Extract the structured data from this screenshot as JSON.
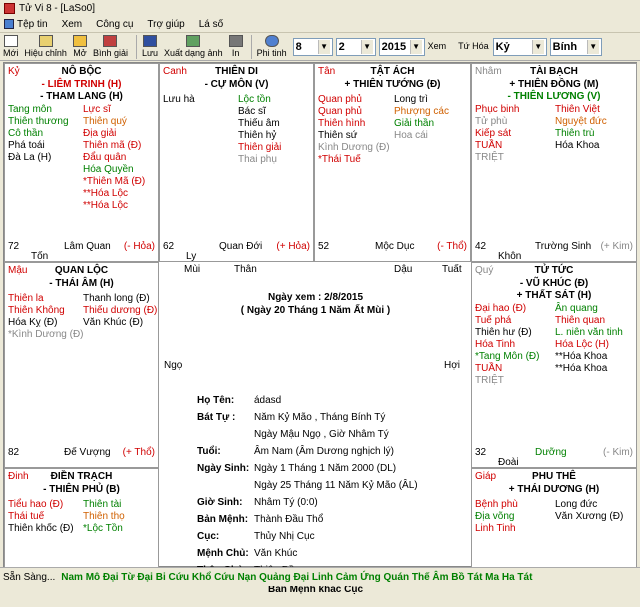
{
  "window": {
    "title": "Tử Vi 8 - [LaSo0]"
  },
  "menu": [
    "Tệp tin",
    "Xem",
    "Công cụ",
    "Trợ giúp",
    "Lá số"
  ],
  "toolbar": {
    "buttons": [
      "Mới",
      "Hiệu chỉnh",
      "Mở",
      "Bình giải",
      "Lưu",
      "Xuất dạng ảnh",
      "In",
      "Phi tinh"
    ],
    "day": "8",
    "month": "2",
    "year": "2015",
    "view_label": "Xem",
    "tu_hoa_label": "Tứ Hóa",
    "can_year": "Kỷ",
    "chi_year": "Bính"
  },
  "palaces": [
    {
      "id": "no-boc",
      "can": "Kỷ",
      "name": "NÔ BỘC",
      "stars": [
        "- LIÊM TRINH (H)",
        "- THAM LANG (H)"
      ],
      "left": [
        [
          "Tang môn",
          "g"
        ],
        [
          "Thiên thương",
          "g"
        ],
        [
          "Cô thần",
          "g"
        ],
        [
          "Phá toái",
          "k"
        ],
        [
          "Đà La (H)",
          "k"
        ]
      ],
      "right": [
        [
          "Lực sĩ",
          "r"
        ],
        [
          "Thiên quý",
          "o"
        ],
        [
          "Địa giải",
          "r"
        ],
        [
          "Thiên mã (Đ)",
          "r"
        ],
        [
          "Đẩu quân",
          "r"
        ],
        [
          "Hóa Quyền",
          "g"
        ],
        [
          "*Thiên Mã (Đ)",
          "r"
        ],
        [
          "**Hóa Lộc",
          "r"
        ],
        [
          "**Hóa Lộc",
          "r"
        ]
      ],
      "num": "72",
      "phase": "Lâm Quan",
      "chi": "Tốn",
      "hoa": "(- Hỏa)"
    },
    {
      "id": "thien-di",
      "can": "Canh",
      "name": "THIÊN DI",
      "stars": [
        "- CỰ MÔN (V)"
      ],
      "left": [
        [
          "Lưu hà",
          "k"
        ]
      ],
      "right": [
        [
          "Lộc tồn",
          "g"
        ],
        [
          "Bác sĩ",
          "k"
        ],
        [
          "Thiếu âm",
          "k"
        ],
        [
          "Thiên hỷ",
          "k"
        ],
        [
          "Thiên giải",
          "r"
        ],
        [
          "Thai phụ",
          "gy"
        ]
      ],
      "num": "62",
      "phase": "Quan Đới",
      "chi": "Ly",
      "hoa": "(+ Hỏa)"
    },
    {
      "id": "tat-ach",
      "can": "Tân",
      "name": "TẬT ÁCH",
      "stars": [
        "+ THIÊN TƯỚNG (Đ)"
      ],
      "left": [
        [
          "Quan phủ",
          "r"
        ],
        [
          "Quan phủ",
          "r"
        ],
        [
          "Thiên hình",
          "r"
        ],
        [
          "Thiên sứ",
          "k"
        ],
        [
          "Kình Dương (Đ)",
          "gy"
        ],
        [
          "*Thái Tuế",
          "r"
        ]
      ],
      "right": [
        [
          "Long trì",
          "k"
        ],
        [
          "Phượng các",
          "o"
        ],
        [
          "Giải thần",
          "g"
        ],
        [
          "Hoa cái",
          "gy"
        ]
      ],
      "num": "52",
      "phase": "Mộc Dục",
      "chi": "",
      "hoa": "(- Thổ)"
    },
    {
      "id": "tai-bach",
      "can": "Nhâm",
      "name": "TÀI BẠCH",
      "stars": [
        "+ THIÊN ĐỒNG (M)",
        "- THIÊN LƯƠNG (V)"
      ],
      "left": [
        [
          "Phục binh",
          "r"
        ],
        [
          "Tử phù",
          "gy"
        ],
        [
          "Kiếp sát",
          "r"
        ],
        [
          "TUẦN",
          "r"
        ],
        [
          "TRIỆT",
          "gy"
        ]
      ],
      "right": [
        [
          "Thiên Việt",
          "r"
        ],
        [
          "Nguyệt đức",
          "o"
        ],
        [
          "Thiên trù",
          "g"
        ],
        [
          "Hóa Khoa",
          "k"
        ]
      ],
      "num": "42",
      "phase": "Trường Sinh",
      "chi": "Khôn",
      "hoa": "(+ Kim)"
    },
    {
      "id": "quan-loc",
      "can": "Mậu",
      "name": "QUAN LỘC",
      "stars": [
        "- THÁI ÂM (H)"
      ],
      "left": [
        [
          "Thiên la",
          "r"
        ],
        [
          "Thiên Không",
          "r"
        ],
        [
          "Hóa Kỵ (Đ)",
          "k"
        ],
        [
          "*Kình Dương (Đ)",
          "gy"
        ]
      ],
      "right": [
        [
          "Thanh long (Đ)",
          "k"
        ],
        [
          "Thiếu dương (Đ)",
          "r"
        ],
        [
          "Văn Khúc (Đ)",
          "k"
        ]
      ],
      "num": "82",
      "phase": "Đế Vượng",
      "chi": "",
      "hoa": "(+ Thổ)"
    },
    {
      "id": "tu-tuc",
      "can": "Quý",
      "name": "TỬ TỨC",
      "stars": [
        "- VŨ KHÚC (Đ)",
        "+ THẤT SÁT (H)"
      ],
      "left": [
        [
          "Đại hao (Đ)",
          "r"
        ],
        [
          "Tuế phá",
          "r"
        ],
        [
          "Thiên hư (Đ)",
          "k"
        ],
        [
          "Hóa Tinh",
          "r"
        ],
        [
          "*Tang Môn (Đ)",
          "g"
        ],
        [
          "TUẦN",
          "r"
        ],
        [
          "TRIỆT",
          "gy"
        ]
      ],
      "right": [
        [
          "Ân quang",
          "g"
        ],
        [
          "Thiên quan",
          "r"
        ],
        [
          "L. niên văn tinh",
          "g"
        ],
        [
          "Hóa Lộc (H)",
          "r"
        ],
        [
          "**Hóa Khoa",
          "k"
        ],
        [
          "**Hóa Khoa",
          "k"
        ]
      ],
      "num": "32",
      "phase": "Dưỡng",
      "chi": "Đoài",
      "hoa": "(- Kim)"
    },
    {
      "id": "dien-trach",
      "can": "Đinh",
      "name": "ĐIỀN TRẠCH",
      "stars": [
        "- THIÊN PHỦ (B)"
      ],
      "left": [
        [
          "Tiểu hao (Đ)",
          "r"
        ],
        [
          "Thái tuế",
          "r"
        ],
        [
          "Thiên khốc (Đ)",
          "k"
        ]
      ],
      "right": [
        [
          "Thiên tài",
          "g"
        ],
        [
          "Thiên thọ",
          "o"
        ],
        [
          "*Lộc Tồn",
          "g"
        ]
      ],
      "num": "",
      "phase": "",
      "chi": "",
      "hoa": ""
    },
    {
      "id": "phu-the",
      "can": "Giáp",
      "name": "PHU THÊ",
      "stars": [
        "+ THÁI DƯƠNG (H)"
      ],
      "left": [
        [
          "Bệnh phù",
          "r"
        ],
        [
          "Địa võng",
          "g"
        ],
        [
          "Linh Tinh",
          "r"
        ]
      ],
      "right": [
        [
          "Long đức",
          "k"
        ],
        [
          "Văn Xương (Đ)",
          "k"
        ]
      ],
      "num": "",
      "phase": "",
      "chi": "",
      "hoa": ""
    }
  ],
  "center": {
    "corners": [
      "Mùi",
      "Thân",
      "Dậu",
      "Tuất",
      "Ngọ",
      "Hợi"
    ],
    "view_date": "Ngày xem : 2/8/2015",
    "view_lunar": "( Ngày 20 Tháng 1 Năm Ất Mùi )",
    "fields": [
      [
        "Họ Tên:",
        "ádasd"
      ],
      [
        "Bát Tự :",
        "Năm Kỷ Mão , Tháng Bính Tý"
      ],
      [
        "",
        "Ngày Mậu Ngọ , Giờ Nhâm Tý"
      ],
      [
        "Tuổi:",
        "Âm Nam (Âm Dương nghịch lý)"
      ],
      [
        "Ngày Sinh:",
        "Ngày 1 Tháng 1 Năm 2000 (DL)"
      ],
      [
        "",
        "Ngày 25 Tháng 11 Năm Kỷ Mão (ÂL)"
      ],
      [
        "Giờ Sinh:",
        "Nhâm Tý (0:0)"
      ],
      [
        "Bản Mệnh:",
        "Thành Đầu Thổ"
      ],
      [
        "Cục:",
        "Thủy Nhị Cục"
      ],
      [
        "Mệnh Chủ:",
        "Văn Khúc"
      ],
      [
        "Thân Chủ:",
        "Thiên Đồng"
      ]
    ],
    "footer": "Bản Mệnh khắc Cục"
  },
  "status": {
    "ready": "Sẵn Sàng...",
    "marquee": "Nam Mô Đại Từ Đại Bi Cứu Khổ Cứu Nạn Quảng Đại Linh Cảm Ứng Quán Thế Âm Bồ Tát Ma Ha Tát"
  }
}
